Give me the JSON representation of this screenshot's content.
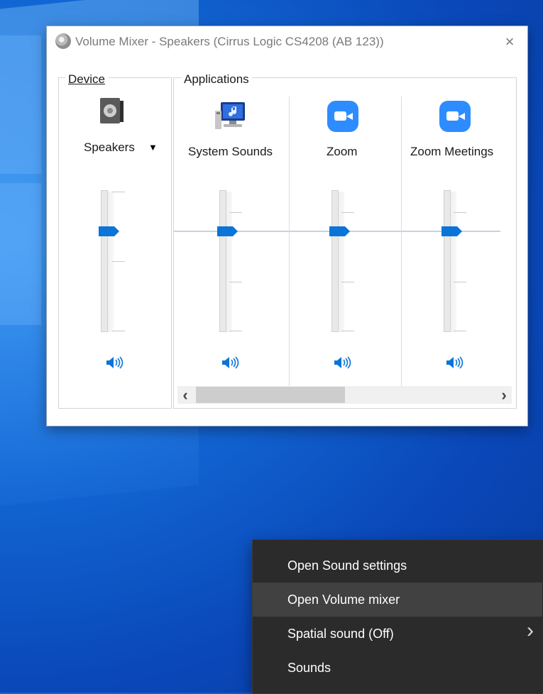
{
  "window": {
    "title": "Volume Mixer - Speakers (Cirrus Logic CS4208 (AB 123))",
    "close_icon": "×"
  },
  "device_group": {
    "label": "Device",
    "device_name": "Speakers",
    "dropdown_icon": "▼",
    "volume_level_percent": 70
  },
  "applications_group": {
    "label": "Applications",
    "apps": [
      {
        "name": "System Sounds",
        "icon": "system-sounds-icon",
        "volume_level_percent": 70
      },
      {
        "name": "Zoom",
        "icon": "zoom-icon",
        "volume_level_percent": 70
      },
      {
        "name": "Zoom Meetings",
        "icon": "zoom-icon",
        "volume_level_percent": 70
      }
    ],
    "scrollbar": {
      "left_arrow": "‹",
      "right_arrow": "›"
    }
  },
  "context_menu": {
    "items": [
      {
        "label": "Open Sound settings"
      },
      {
        "label": "Open Volume mixer",
        "highlighted": true
      },
      {
        "label": "Spatial sound (Off)",
        "has_submenu": true,
        "chevron": "›"
      },
      {
        "label": "Sounds"
      }
    ]
  },
  "colors": {
    "accent": "#0a74d8",
    "desktop": "#0a47b8",
    "menu_bg": "#2b2b2b",
    "menu_highlight": "#414141"
  }
}
